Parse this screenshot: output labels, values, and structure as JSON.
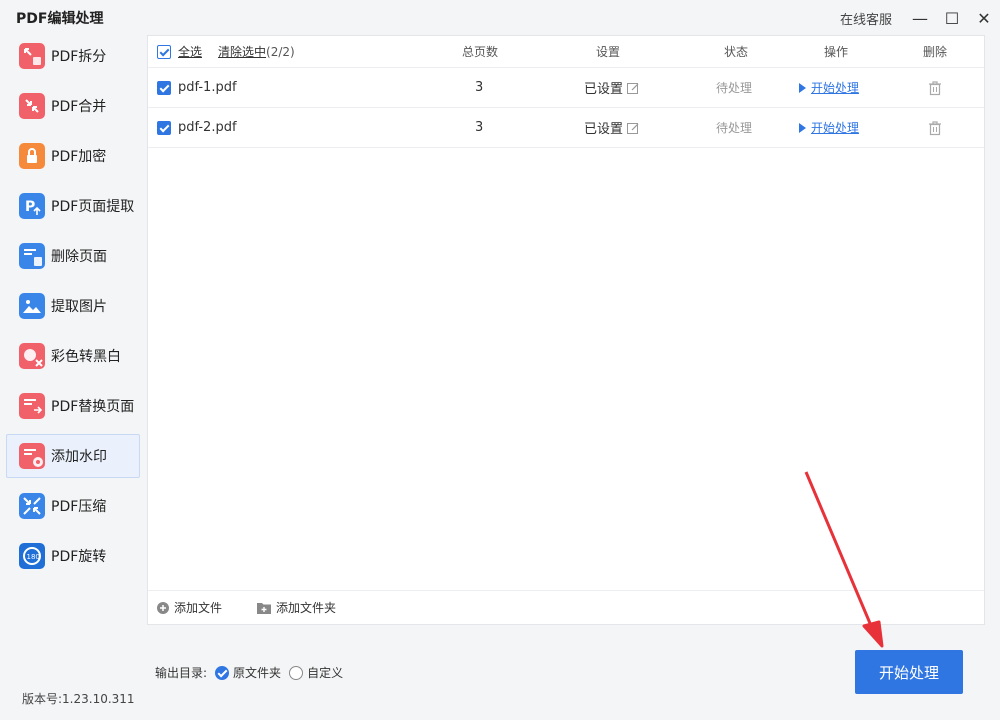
{
  "app": {
    "title": "PDF编辑处理",
    "online_service": "在线客服"
  },
  "window": {
    "minimize": "—",
    "maximize": "☐",
    "close": "✕"
  },
  "sidebar": {
    "items": [
      {
        "label": "PDF拆分",
        "icon": "split-icon",
        "color": "#f0616a"
      },
      {
        "label": "PDF合并",
        "icon": "merge-icon",
        "color": "#f0616a"
      },
      {
        "label": "PDF加密",
        "icon": "lock-icon",
        "color": "#f58a3c"
      },
      {
        "label": "PDF页面提取",
        "icon": "page-extract-icon",
        "color": "#3a86e8"
      },
      {
        "label": "删除页面",
        "icon": "delete-page-icon",
        "color": "#3a86e8"
      },
      {
        "label": "提取图片",
        "icon": "image-extract-icon",
        "color": "#3a86e8"
      },
      {
        "label": "彩色转黑白",
        "icon": "color-to-bw-icon",
        "color": "#f0616a"
      },
      {
        "label": "PDF替换页面",
        "icon": "replace-page-icon",
        "color": "#f0616a"
      },
      {
        "label": "添加水印",
        "icon": "watermark-icon",
        "color": "#f0616a"
      },
      {
        "label": "PDF压缩",
        "icon": "compress-icon",
        "color": "#3a86e8"
      },
      {
        "label": "PDF旋转",
        "icon": "rotate-icon",
        "color": "#1f6fd6"
      }
    ],
    "active_index": 8
  },
  "table": {
    "select_all": "全选",
    "clear_selected": "清除选中",
    "selected_count": "(2/2)",
    "columns": {
      "pages": "总页数",
      "settings": "设置",
      "status": "状态",
      "action": "操作",
      "delete": "删除"
    },
    "rows": [
      {
        "name": "pdf-1.pdf",
        "pages": "3",
        "settings": "已设置",
        "status": "待处理",
        "action": "开始处理"
      },
      {
        "name": "pdf-2.pdf",
        "pages": "3",
        "settings": "已设置",
        "status": "待处理",
        "action": "开始处理"
      }
    ]
  },
  "footer": {
    "add_file": "添加文件",
    "add_folder": "添加文件夹"
  },
  "output": {
    "label": "输出目录:",
    "option_original": "原文件夹",
    "option_custom": "自定义",
    "selected": "原文件夹"
  },
  "start_button": "开始处理",
  "version": "版本号:1.23.10.311",
  "colors": {
    "accent": "#2f76e2",
    "annotation_arrow": "#e8323a"
  }
}
